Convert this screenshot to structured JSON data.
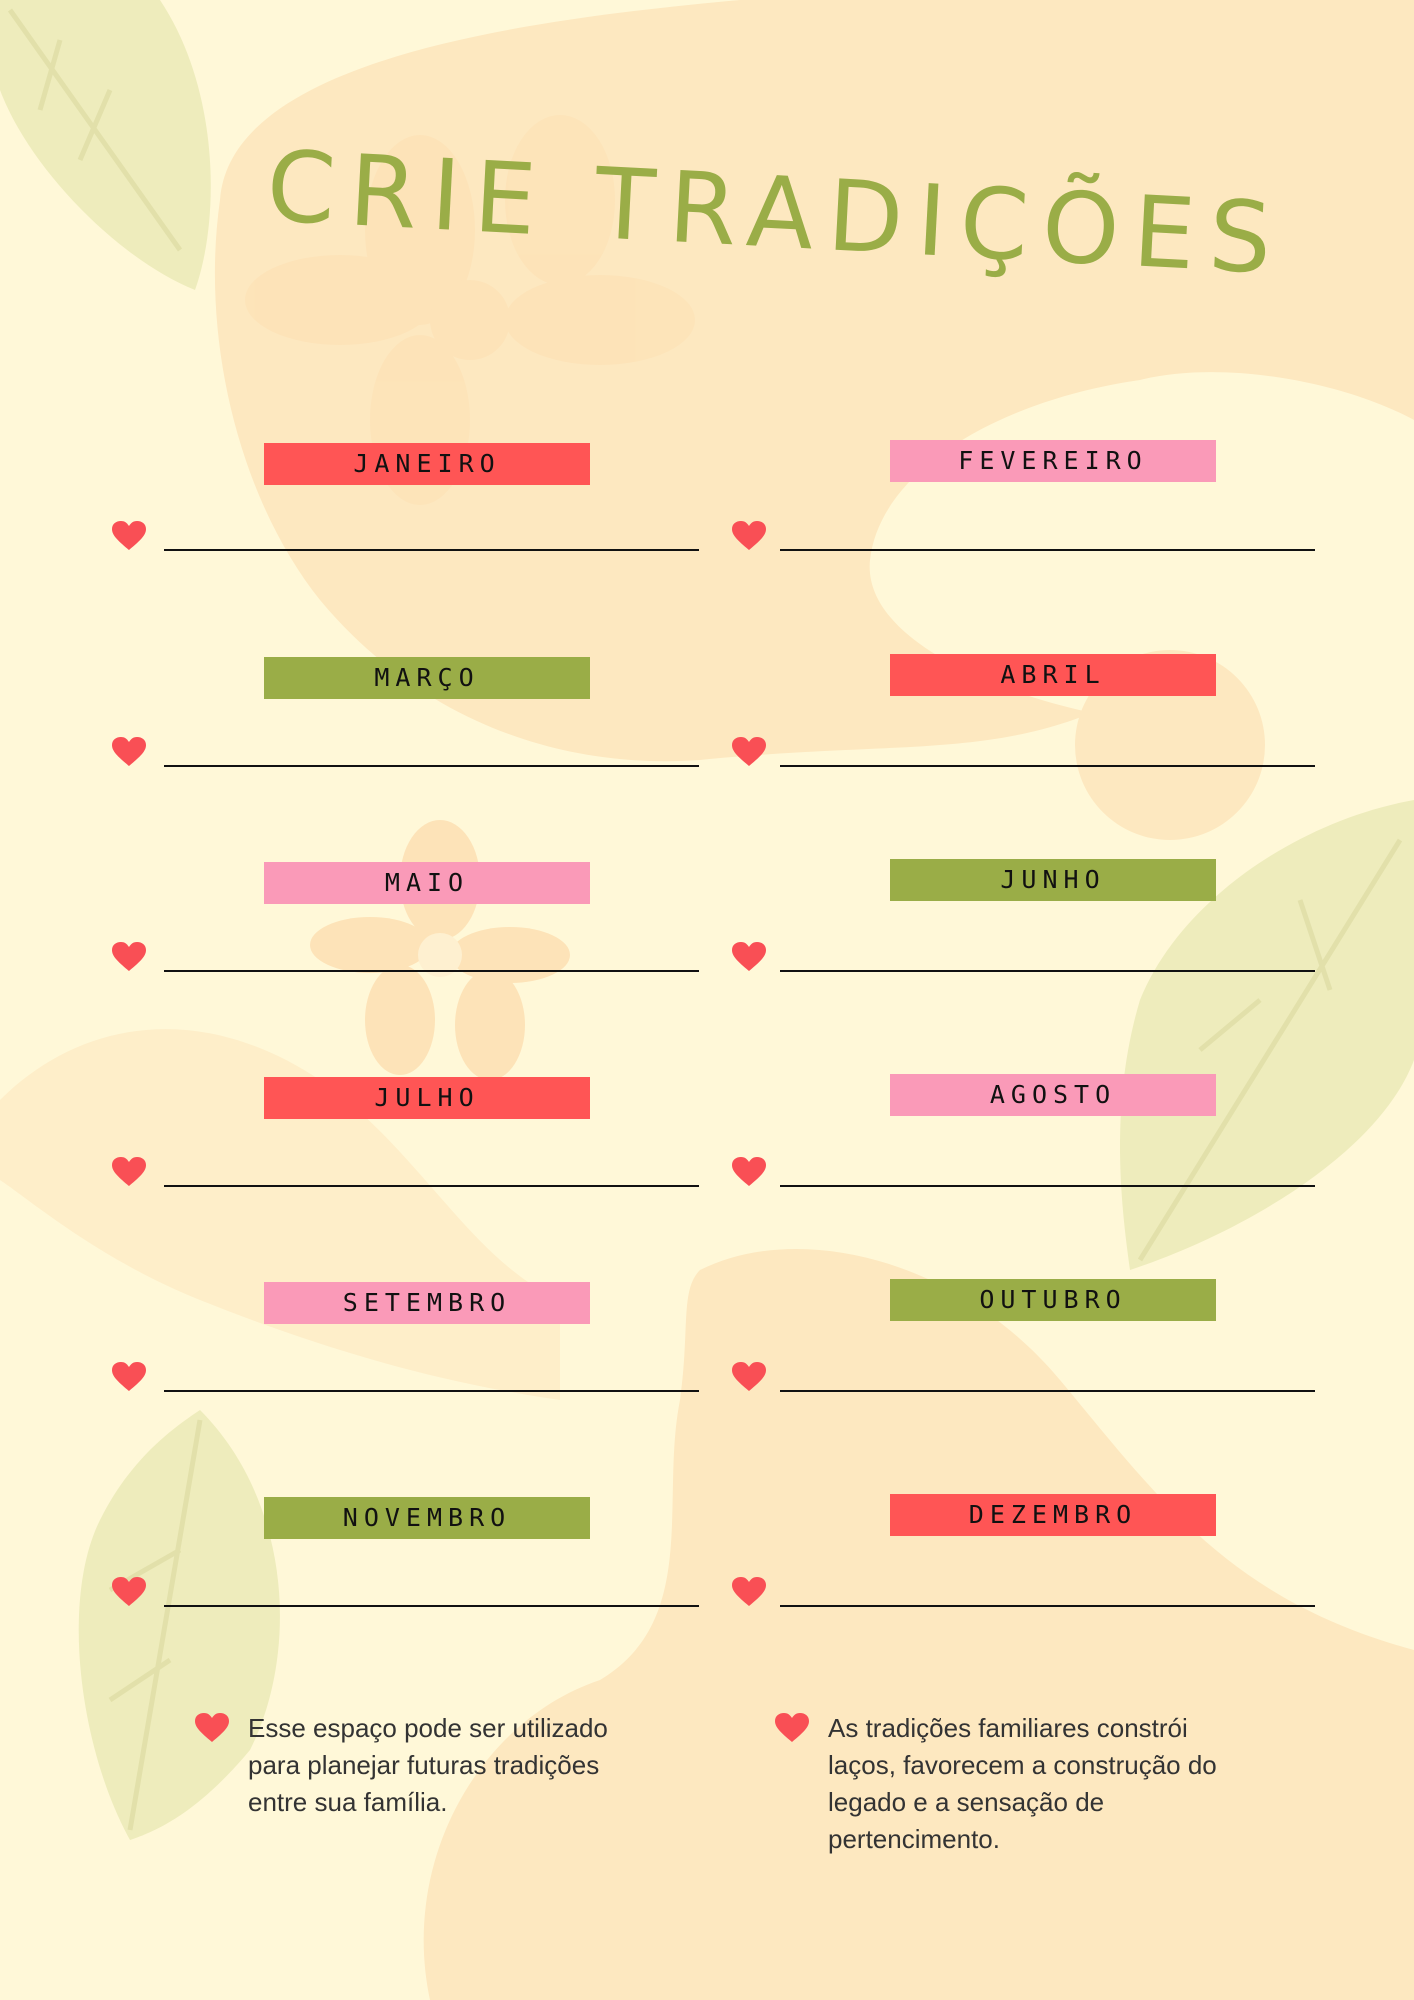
{
  "title": "CRIE TRADIÇÕES",
  "colors": {
    "red": "#ff5555",
    "pink": "#fa9ab8",
    "green": "#9aad47",
    "heart": "#f94f55",
    "background": "#fff8d8"
  },
  "months": [
    {
      "label": "JANEIRO",
      "color": "red"
    },
    {
      "label": "FEVEREIRO",
      "color": "pink"
    },
    {
      "label": "MARÇO",
      "color": "green"
    },
    {
      "label": "ABRIL",
      "color": "red"
    },
    {
      "label": "MAIO",
      "color": "pink"
    },
    {
      "label": "JUNHO",
      "color": "green"
    },
    {
      "label": "JULHO",
      "color": "red"
    },
    {
      "label": "AGOSTO",
      "color": "pink"
    },
    {
      "label": "SETEMBRO",
      "color": "pink"
    },
    {
      "label": "OUTUBRO",
      "color": "green"
    },
    {
      "label": "NOVEMBRO",
      "color": "green"
    },
    {
      "label": "DEZEMBRO",
      "color": "red"
    }
  ],
  "notes": [
    {
      "text": "Esse espaço pode ser utilizado para planejar futuras tradições entre sua família."
    },
    {
      "text": "As tradições familiares constrói laços, favorecem a construção do legado e a sensação de pertencimento."
    }
  ]
}
